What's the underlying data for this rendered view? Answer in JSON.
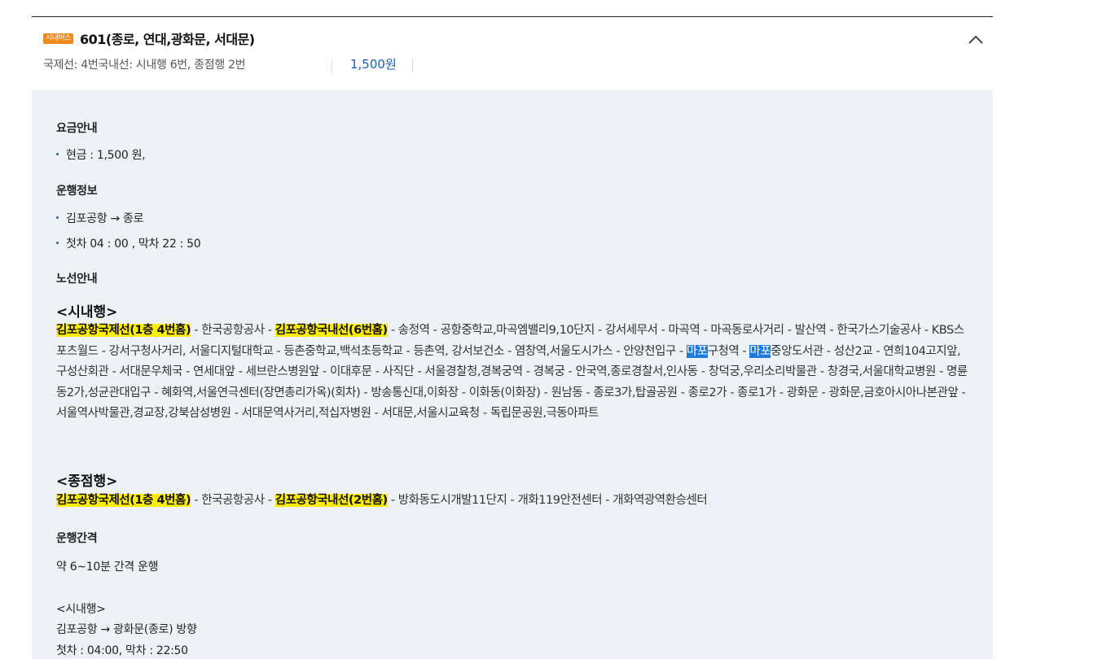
{
  "header": {
    "badge": "시내버스",
    "route_name": "601(종로, 연대,광화문, 서대문)",
    "subtitle": "국제선: 4번국내선: 시내행 6번, 종점행 2번",
    "fare": "1,500원"
  },
  "fare_info": {
    "title": "요금안내",
    "items": [
      "현금 : 1,500 원,"
    ]
  },
  "operation_info": {
    "title": "운행정보",
    "items": [
      "김포공항 → 종로",
      "첫차 04 : 00 , 막차 22 : 50"
    ]
  },
  "route_info": {
    "title": "노선안내",
    "downtown": {
      "title": "<시내행>",
      "hl1": "김포공항국제선(1층 4번홈)",
      "t1": " - 한국공항공사 - ",
      "hl2": "김포공항국내선(6번홈)",
      "t2": " - 송정역 - 공항중학교,마곡엠밸리9,10단지 - 강서세무서 - 마곡역 - 마곡동로사거리 - 발산역 - 한국가스기술공사 - KBS스포츠월드 - 강서구청사거리, 서울디지털대학교 - 등촌중학교,백석초등학교 - 등촌역, 강서보건소 - 염창역,서울도시가스 - 안양천입구 - ",
      "sel1": "마포",
      "t3": "구청역 - ",
      "sel2": "마포",
      "t4": "중앙도서관 - 성산2교 - 연희104고지앞,구성산회관 - 서대문우체국 - 연세대앞 - 세브란스병원앞 - 이대후문 - 사직단 - 서울경찰청,경복궁역 - 경복궁 - 안국역,종로경찰서,인사동 - 창덕궁,우리소리박물관 - 창경국,서울대학교병원 - 명륜동2가,성균관대입구 - 혜화역,서울연극센터(장면총리가옥)(회차) - 방송통신대,이화장 - 이화동(이화장) - 원남동 - 종로3가,탑골공원 - 종로2가 - 종로1가 - 광화문 - 광화문,금호아시아나본관앞 - 서울역사박물관,경교장,강북삼성병원 - 서대문역사거리,적십자병원 - 서대문,서울시교육청 - 독립문공원,극동아파트"
    },
    "terminal": {
      "title": "<종점행>",
      "hl1": "김포공항국제선(1층 4번홈)",
      "t1": " - 한국공항공사 - ",
      "hl2": "김포공항국내선(2번홈)",
      "t2": " - 방화동도시개발11단지 - 개화119안전센터 - 개화역광역환승센터"
    }
  },
  "interval_info": {
    "title": "운행간격",
    "text": "약 6~10분 간격 운행",
    "lines": [
      "<시내행>",
      "김포공항 → 광화문(종로) 방향",
      "첫차 : 04:00, 막차 : 22:50"
    ]
  },
  "colors": {
    "accent": "#1a5fb4",
    "badge": "#f08a1c",
    "highlight": "#ffee00",
    "panel": "#eef1f6"
  }
}
